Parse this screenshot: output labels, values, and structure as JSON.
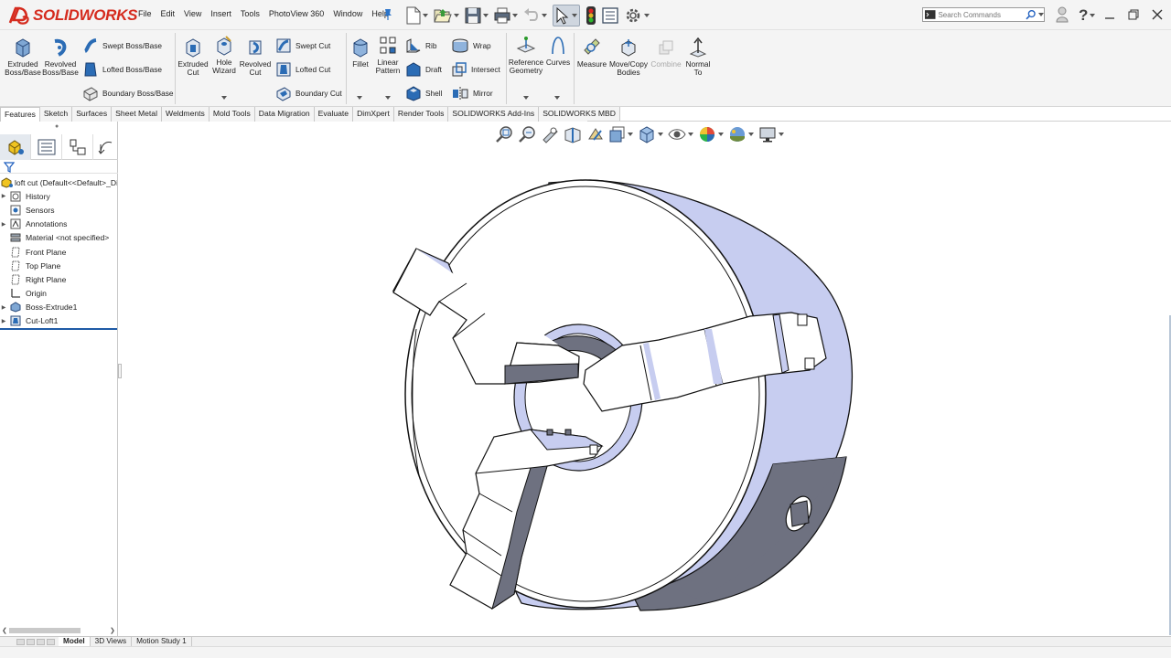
{
  "app": {
    "brand": "SOLIDWORKS"
  },
  "menu": [
    "File",
    "Edit",
    "View",
    "Insert",
    "Tools",
    "PhotoView 360",
    "Window",
    "Help"
  ],
  "search": {
    "placeholder": "Search Commands"
  },
  "ribbon": {
    "extruded_boss": "Extruded Boss/Base",
    "revolved_boss": "Revolved Boss/Base",
    "swept_boss": "Swept Boss/Base",
    "lofted_boss": "Lofted Boss/Base",
    "boundary_boss": "Boundary Boss/Base",
    "extruded_cut": "Extruded Cut",
    "hole_wizard": "Hole Wizard",
    "revolved_cut": "Revolved Cut",
    "swept_cut": "Swept Cut",
    "lofted_cut": "Lofted Cut",
    "boundary_cut": "Boundary Cut",
    "fillet": "Fillet",
    "linear_pattern": "Linear Pattern",
    "rib": "Rib",
    "draft": "Draft",
    "shell": "Shell",
    "wrap": "Wrap",
    "intersect": "Intersect",
    "mirror": "Mirror",
    "reference_geometry": "Reference Geometry",
    "curves": "Curves",
    "measure": "Measure",
    "move_copy_bodies": "Move/Copy Bodies",
    "combine": "Combine",
    "normal_to": "Normal To"
  },
  "tabs": [
    "Features",
    "Sketch",
    "Surfaces",
    "Sheet Metal",
    "Weldments",
    "Mold Tools",
    "Data Migration",
    "Evaluate",
    "DimXpert",
    "Render Tools",
    "SOLIDWORKS Add-Ins",
    "SOLIDWORKS MBD"
  ],
  "active_tab": "Features",
  "tree": {
    "root": "loft cut  (Default<<Default>_Di",
    "items": [
      {
        "label": "History",
        "icon": "history-icon",
        "expandable": true
      },
      {
        "label": "Sensors",
        "icon": "sensors-icon",
        "expandable": false
      },
      {
        "label": "Annotations",
        "icon": "annotations-icon",
        "expandable": true
      },
      {
        "label": "Material <not specified>",
        "icon": "material-icon",
        "expandable": false
      },
      {
        "label": "Front Plane",
        "icon": "plane-icon",
        "expandable": false
      },
      {
        "label": "Top Plane",
        "icon": "plane-icon",
        "expandable": false
      },
      {
        "label": "Right Plane",
        "icon": "plane-icon",
        "expandable": false
      },
      {
        "label": "Origin",
        "icon": "origin-icon",
        "expandable": false
      },
      {
        "label": "Boss-Extrude1",
        "icon": "boss-extrude-icon",
        "expandable": true
      },
      {
        "label": "Cut-Loft1",
        "icon": "cut-loft-icon",
        "expandable": true
      }
    ]
  },
  "bottom_tabs": [
    "Model",
    "3D Views",
    "Motion Study 1"
  ],
  "active_bottom_tab": "Model",
  "colors": {
    "face_light": "#c7cdf0",
    "face_dark": "#6e7180",
    "brand_red": "#d52b1e",
    "accent_blue": "#1e5aa6"
  }
}
